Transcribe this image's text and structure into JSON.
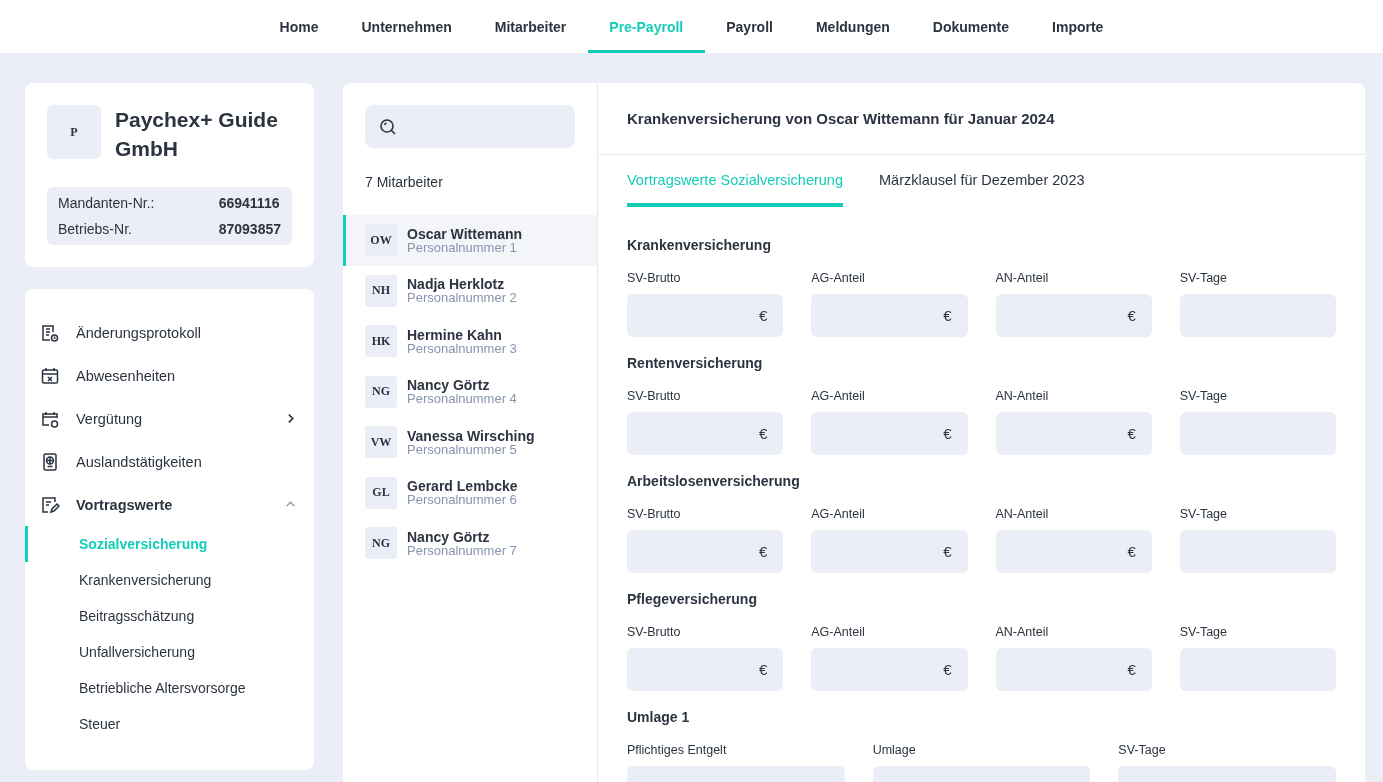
{
  "nav": [
    {
      "label": "Home",
      "selected": false
    },
    {
      "label": "Unternehmen",
      "selected": false
    },
    {
      "label": "Mitarbeiter",
      "selected": false
    },
    {
      "label": "Pre-Payroll",
      "selected": true
    },
    {
      "label": "Payroll",
      "selected": false
    },
    {
      "label": "Meldungen",
      "selected": false
    },
    {
      "label": "Dokumente",
      "selected": false
    },
    {
      "label": "Importe",
      "selected": false
    }
  ],
  "company": {
    "initial": "P",
    "name": "Paychex+ Guide GmbH",
    "facts": [
      {
        "label": "Mandanten-Nr.:",
        "value": "66941116"
      },
      {
        "label": "Betriebs-Nr.",
        "value": "87093857"
      }
    ]
  },
  "menu": [
    {
      "label": "Änderungsprotokoll"
    },
    {
      "label": "Abwesenheiten"
    },
    {
      "label": "Vergütung",
      "expanded": false
    },
    {
      "label": "Auslandstätigkeiten"
    },
    {
      "label": "Vortragswerte",
      "expanded": true,
      "children": [
        {
          "label": "Sozialversicherung",
          "selected": true
        },
        {
          "label": "Krankenversicherung",
          "selected": false
        },
        {
          "label": "Beitragsschätzung",
          "selected": false
        },
        {
          "label": "Unfallversicherung",
          "selected": false
        },
        {
          "label": "Betriebliche Altersvorsorge",
          "selected": false
        },
        {
          "label": "Steuer",
          "selected": false
        }
      ]
    }
  ],
  "employees": {
    "count": "7 Mitarbeiter",
    "items": [
      {
        "initials": "OW",
        "name": "Oscar Wittemann",
        "number": "Personalnummer 1",
        "selected": true
      },
      {
        "initials": "NH",
        "name": "Nadja Herklotz",
        "number": "Personalnummer 2",
        "selected": false
      },
      {
        "initials": "HK",
        "name": "Hermine Kahn",
        "number": "Personalnummer 3",
        "selected": false
      },
      {
        "initials": "NG",
        "name": "Nancy Görtz",
        "number": "Personalnummer 4",
        "selected": false
      },
      {
        "initials": "VW",
        "name": "Vanessa Wirsching",
        "number": "Personalnummer 5",
        "selected": false
      },
      {
        "initials": "GL",
        "name": "Gerard Lembcke",
        "number": "Personalnummer 6",
        "selected": false
      },
      {
        "initials": "NG",
        "name": "Nancy Görtz",
        "number": "Personalnummer 7",
        "selected": false
      }
    ]
  },
  "detail": {
    "title": "Krankenversicherung von Oscar Wittemann für Januar 2024",
    "tabs": [
      {
        "label": "Vortragswerte Sozialversicherung",
        "selected": true
      },
      {
        "label": "Märzklausel für Dezember 2023",
        "selected": false
      }
    ],
    "sections": [
      {
        "title": "Krankenversicherung",
        "fields": [
          {
            "label": "SV-Brutto",
            "suffix": "€"
          },
          {
            "label": "AG-Anteil",
            "suffix": "€"
          },
          {
            "label": "AN-Anteil",
            "suffix": "€"
          },
          {
            "label": "SV-Tage"
          }
        ]
      },
      {
        "title": "Rentenversicherung",
        "fields": [
          {
            "label": "SV-Brutto",
            "suffix": "€"
          },
          {
            "label": "AG-Anteil",
            "suffix": "€"
          },
          {
            "label": "AN-Anteil",
            "suffix": "€"
          },
          {
            "label": "SV-Tage"
          }
        ]
      },
      {
        "title": "Arbeitslosenversicherung",
        "fields": [
          {
            "label": "SV-Brutto",
            "suffix": "€"
          },
          {
            "label": "AG-Anteil",
            "suffix": "€"
          },
          {
            "label": "AN-Anteil",
            "suffix": "€"
          },
          {
            "label": "SV-Tage"
          }
        ]
      },
      {
        "title": "Pflegeversicherung",
        "fields": [
          {
            "label": "SV-Brutto",
            "suffix": "€"
          },
          {
            "label": "AG-Anteil",
            "suffix": "€"
          },
          {
            "label": "AN-Anteil",
            "suffix": "€"
          },
          {
            "label": "SV-Tage"
          }
        ]
      },
      {
        "title": "Umlage 1",
        "fields": [
          {
            "label": "Pflichtiges Entgelt"
          },
          {
            "label": "Umlage"
          },
          {
            "label": "SV-Tage"
          }
        ]
      }
    ]
  }
}
